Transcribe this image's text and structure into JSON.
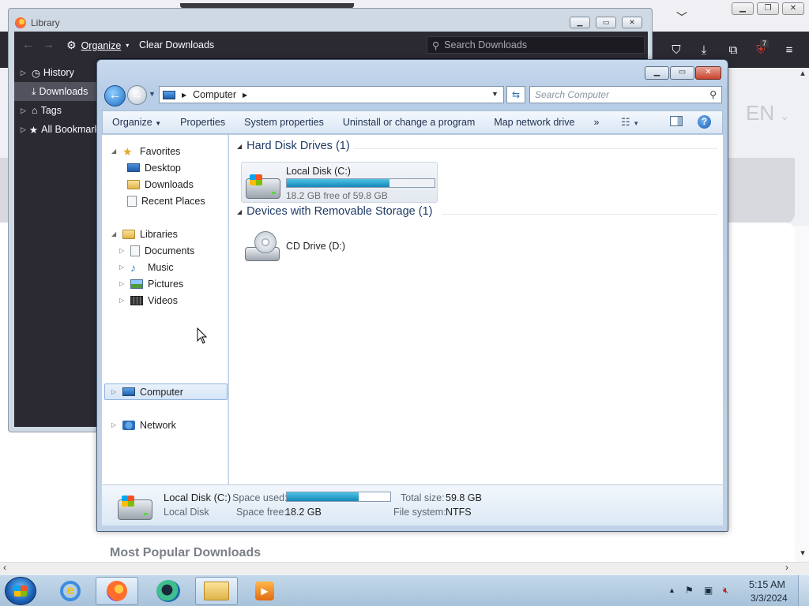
{
  "firefox": {
    "language_selector": "EN",
    "section_heading": "Most Popular Downloads",
    "extension_badge_count": "7"
  },
  "library": {
    "title": "Library",
    "organize_label": "Organize",
    "clear_downloads_label": "Clear Downloads",
    "search_placeholder": "Search Downloads",
    "sidebar": [
      {
        "label": "History"
      },
      {
        "label": "Downloads"
      },
      {
        "label": "Tags"
      },
      {
        "label": "All Bookmarks"
      }
    ]
  },
  "explorer": {
    "address_path": "Computer",
    "search_placeholder": "Search Computer",
    "commands": [
      "Organize",
      "Properties",
      "System properties",
      "Uninstall or change a program",
      "Map network drive"
    ],
    "more_commands": "»",
    "nav": {
      "favorites_label": "Favorites",
      "favorites": [
        "Desktop",
        "Downloads",
        "Recent Places"
      ],
      "libraries_label": "Libraries",
      "libraries": [
        "Documents",
        "Music",
        "Pictures",
        "Videos"
      ],
      "computer_label": "Computer",
      "network_label": "Network"
    },
    "groups": {
      "hard_disk_header": "Hard Disk Drives (1)",
      "removable_header": "Devices with Removable Storage (1)"
    },
    "drive_c": {
      "name": "Local Disk (C:)",
      "free_text": "18.2 GB free of 59.8 GB",
      "used_fraction": 0.696
    },
    "drive_d": {
      "name": "CD Drive (D:)"
    },
    "details": {
      "name": "Local Disk (C:)",
      "type": "Local Disk",
      "space_used_label": "Space used:",
      "space_free_label": "Space free:",
      "space_free_value": "18.2 GB",
      "total_size_label": "Total size:",
      "total_size_value": "59.8 GB",
      "file_system_label": "File system:",
      "file_system_value": "NTFS"
    }
  },
  "taskbar": {
    "time": "5:15 AM",
    "date": "3/3/2024"
  },
  "colors": {
    "firefox_toolbar": "#2b2a33",
    "explorer_frame": "#bfd2e8",
    "progress_fill": "#1687b8"
  }
}
